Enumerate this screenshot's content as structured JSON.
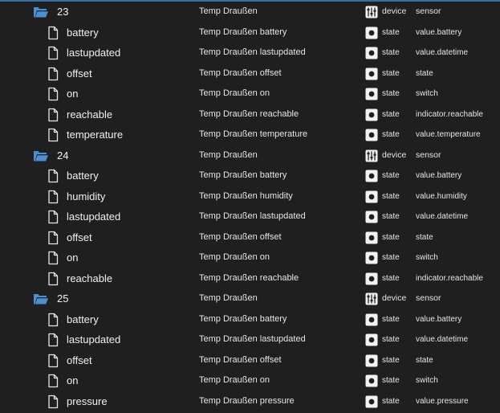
{
  "tree": {
    "rows": [
      {
        "kind": "device",
        "id": "23",
        "name": "Temp Draußen",
        "type": "device",
        "role": "sensor"
      },
      {
        "kind": "state",
        "id": "battery",
        "name": "Temp Draußen battery",
        "type": "state",
        "role": "value.battery"
      },
      {
        "kind": "state",
        "id": "lastupdated",
        "name": "Temp Draußen lastupdated",
        "type": "state",
        "role": "value.datetime"
      },
      {
        "kind": "state",
        "id": "offset",
        "name": "Temp Draußen offset",
        "type": "state",
        "role": "state"
      },
      {
        "kind": "state",
        "id": "on",
        "name": "Temp Draußen on",
        "type": "state",
        "role": "switch"
      },
      {
        "kind": "state",
        "id": "reachable",
        "name": "Temp Draußen reachable",
        "type": "state",
        "role": "indicator.reachable"
      },
      {
        "kind": "state",
        "id": "temperature",
        "name": "Temp Draußen temperature",
        "type": "state",
        "role": "value.temperature"
      },
      {
        "kind": "device",
        "id": "24",
        "name": "Temp Draußen",
        "type": "device",
        "role": "sensor"
      },
      {
        "kind": "state",
        "id": "battery",
        "name": "Temp Draußen battery",
        "type": "state",
        "role": "value.battery"
      },
      {
        "kind": "state",
        "id": "humidity",
        "name": "Temp Draußen humidity",
        "type": "state",
        "role": "value.humidity"
      },
      {
        "kind": "state",
        "id": "lastupdated",
        "name": "Temp Draußen lastupdated",
        "type": "state",
        "role": "value.datetime"
      },
      {
        "kind": "state",
        "id": "offset",
        "name": "Temp Draußen offset",
        "type": "state",
        "role": "state"
      },
      {
        "kind": "state",
        "id": "on",
        "name": "Temp Draußen on",
        "type": "state",
        "role": "switch"
      },
      {
        "kind": "state",
        "id": "reachable",
        "name": "Temp Draußen reachable",
        "type": "state",
        "role": "indicator.reachable"
      },
      {
        "kind": "device",
        "id": "25",
        "name": "Temp Draußen",
        "type": "device",
        "role": "sensor"
      },
      {
        "kind": "state",
        "id": "battery",
        "name": "Temp Draußen battery",
        "type": "state",
        "role": "value.battery"
      },
      {
        "kind": "state",
        "id": "lastupdated",
        "name": "Temp Draußen lastupdated",
        "type": "state",
        "role": "value.datetime"
      },
      {
        "kind": "state",
        "id": "offset",
        "name": "Temp Draußen offset",
        "type": "state",
        "role": "state"
      },
      {
        "kind": "state",
        "id": "on",
        "name": "Temp Draußen on",
        "type": "state",
        "role": "switch"
      },
      {
        "kind": "state",
        "id": "pressure",
        "name": "Temp Draußen pressure",
        "type": "state",
        "role": "value.pressure"
      }
    ]
  },
  "colors": {
    "background": "#1f1f1f",
    "folder_icon": "#4a8fd0",
    "text": "#e6e6e6",
    "accent_line": "#2f6fa6"
  },
  "icons": {
    "device_folder": "folder-open-icon",
    "state_file": "file-icon",
    "device_type": "sliders-icon",
    "state_type": "dot-icon"
  }
}
